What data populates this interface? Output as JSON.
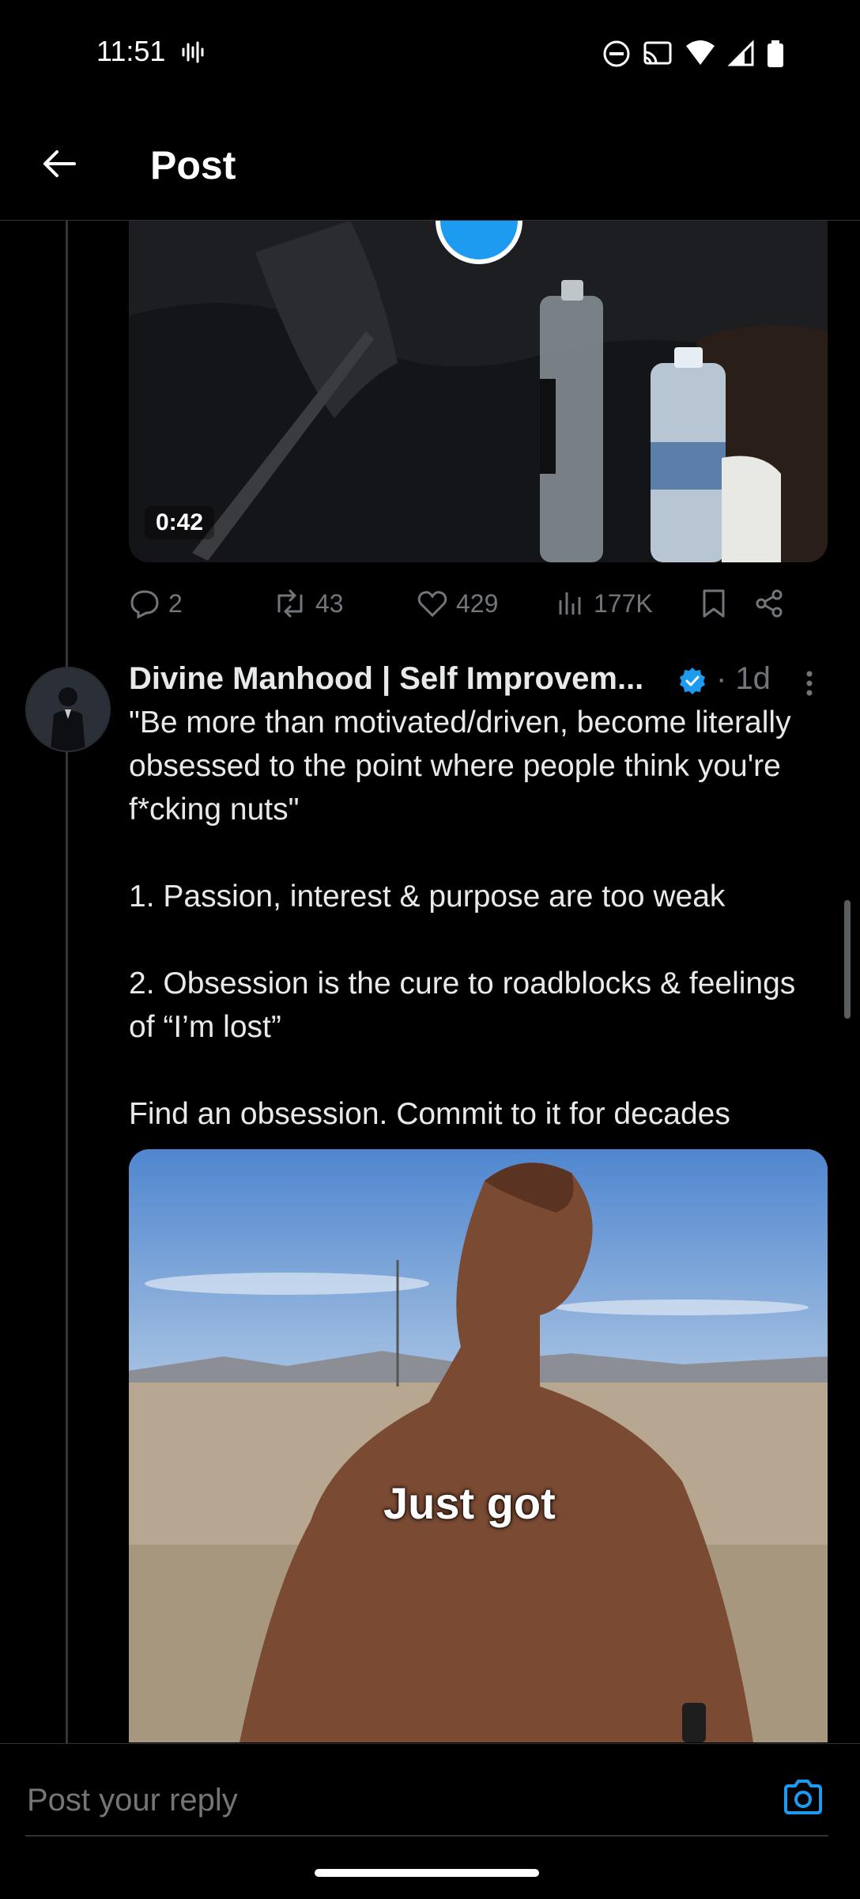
{
  "status_bar": {
    "time": "11:51"
  },
  "header": {
    "title": "Post"
  },
  "video": {
    "duration": "0:42"
  },
  "actions": {
    "replies": "2",
    "reposts": "43",
    "likes": "429",
    "views": "177K"
  },
  "tweet": {
    "author": "Divine Manhood | Self Improvem...",
    "time": "· 1d",
    "body": "\"Be more than motivated/driven, become literally obsessed to the point where people think you're f*cking nuts\"\n\n1. Passion, interest & purpose are too weak\n\n2. Obsession is the cure to roadblocks & feelings of “I’m lost”\n\nFind an obsession. Commit to it for decades",
    "media_caption": "Just got"
  },
  "reply": {
    "placeholder": "Post your reply"
  },
  "colors": {
    "accent": "#1d9bf0",
    "muted": "#71767b",
    "text": "#e7e9ea",
    "background": "#000000"
  }
}
